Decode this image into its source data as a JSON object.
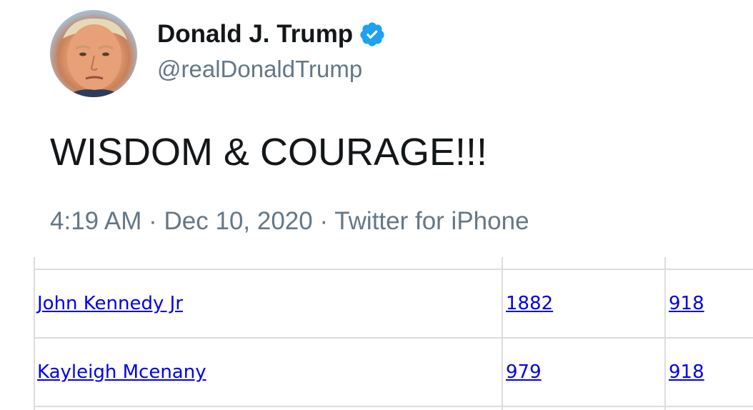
{
  "tweet": {
    "display_name": "Donald J. Trump",
    "handle": "@realDonaldTrump",
    "verified_icon": "verified-badge-icon",
    "text": "WISDOM & COURAGE!!!",
    "meta": "4:19 AM · Dec 10, 2020 · Twitter for iPhone",
    "accent_color": "#1da1f2"
  },
  "table": {
    "rows": [
      {
        "name": "John Kennedy Jr",
        "col2": "1882",
        "col3": "918"
      },
      {
        "name": "Kayleigh Mcenany",
        "col2": "979",
        "col3": "918"
      }
    ],
    "link_color": "#0000ee"
  }
}
